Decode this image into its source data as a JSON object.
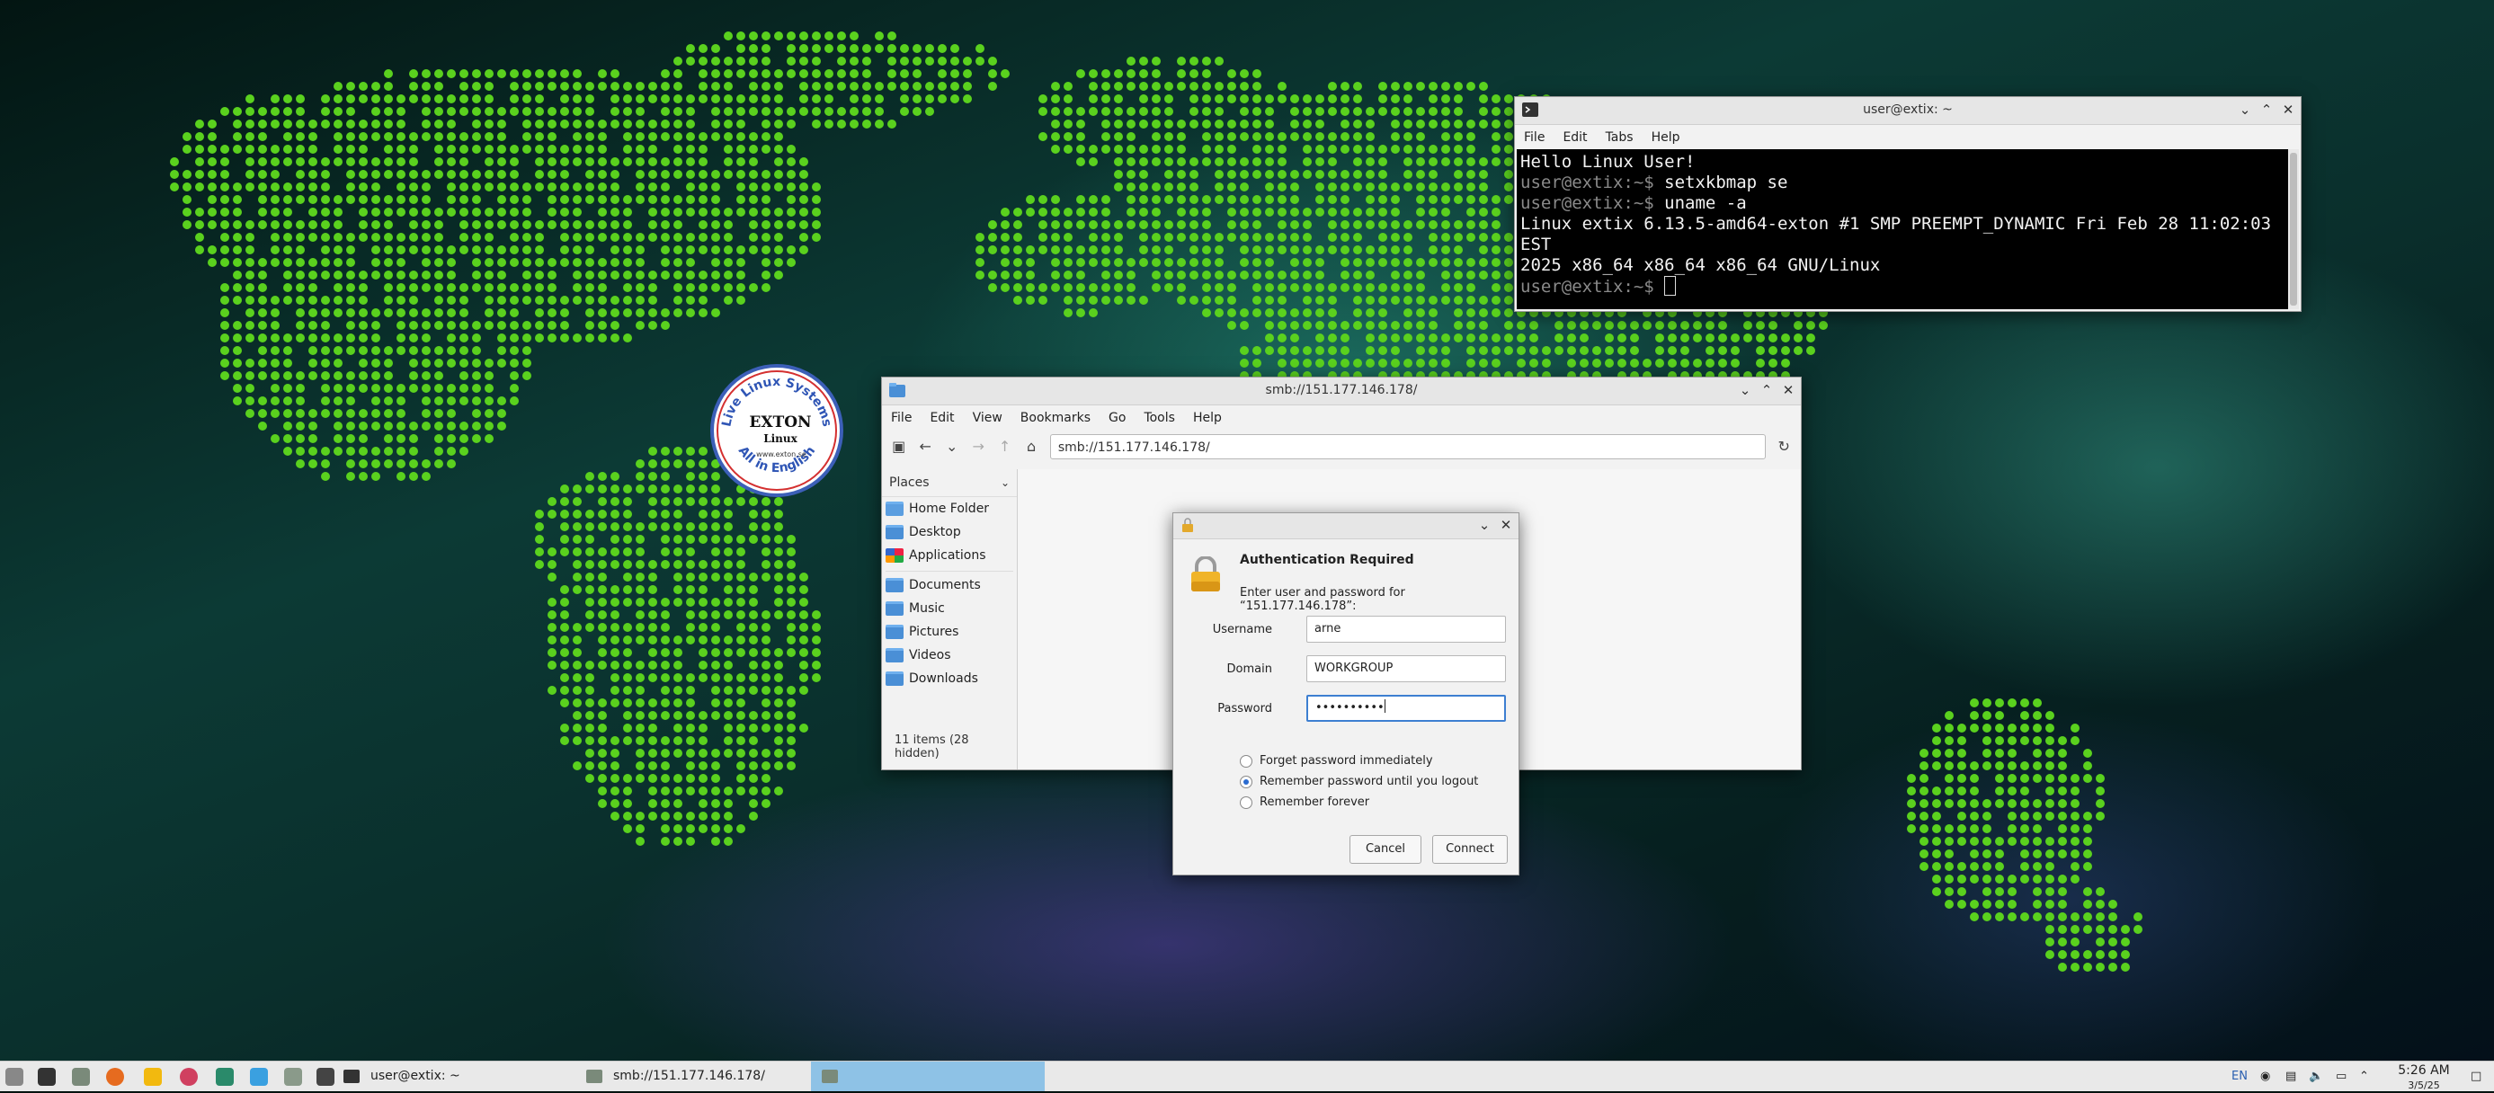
{
  "terminal": {
    "title": "user@extix: ~",
    "menu": [
      "File",
      "Edit",
      "Tabs",
      "Help"
    ],
    "lines": [
      {
        "prompt": "",
        "text": "Hello Linux User!"
      },
      {
        "prompt": "user@extix:~$",
        "text": " setxkbmap se"
      },
      {
        "prompt": "user@extix:~$",
        "text": " uname -a"
      },
      {
        "prompt": "",
        "text": "Linux extix 6.13.5-amd64-exton #1 SMP PREEMPT_DYNAMIC Fri Feb 28 11:02:03 EST"
      },
      {
        "prompt": "",
        "text": "2025 x86_64 x86_64 x86_64 GNU/Linux"
      },
      {
        "prompt": "user@extix:~$",
        "text": " "
      }
    ]
  },
  "badge": {
    "ring_top": "Live Linux Systems",
    "ring_bottom": "All in English",
    "brand_line1": "EXTON",
    "brand_line2": "Linux",
    "url": "www.exton.se"
  },
  "filemanager": {
    "title": "smb://151.177.146.178/",
    "menu": [
      "File",
      "Edit",
      "View",
      "Bookmarks",
      "Go",
      "Tools",
      "Help"
    ],
    "location": "smb://151.177.146.178/",
    "places_label": "Places",
    "places_group1": [
      "Home Folder",
      "Desktop",
      "Applications"
    ],
    "places_group2": [
      "Documents",
      "Music",
      "Pictures",
      "Videos",
      "Downloads"
    ],
    "status": "11 items (28 hidden)"
  },
  "auth": {
    "heading": "Authentication Required",
    "prompt": "Enter user and password for “151.177.146.178”:",
    "username_label": "Username",
    "username_value": "arne",
    "domain_label": "Domain",
    "domain_value": "WORKGROUP",
    "password_label": "Password",
    "password_value": "••••••••••",
    "options": [
      {
        "label": "Forget password immediately",
        "selected": false
      },
      {
        "label": "Remember password until you logout",
        "selected": true
      },
      {
        "label": "Remember forever",
        "selected": false
      }
    ],
    "cancel": "Cancel",
    "connect": "Connect"
  },
  "taskbar": {
    "tasks": [
      "user@extix: ~",
      "smb://151.177.146.178/"
    ],
    "keyboard_layout": "EN",
    "time": "5:26 AM",
    "date": "3/5/25"
  }
}
